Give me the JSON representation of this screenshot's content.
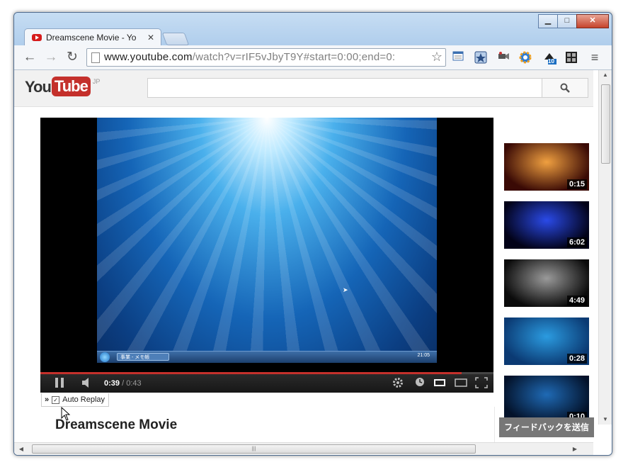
{
  "window": {
    "minimize": "▁",
    "maximize": "□",
    "close": "✕"
  },
  "tab": {
    "title": "Dreamscene Movie - Yo",
    "close": "✕"
  },
  "toolbar": {
    "back": "←",
    "forward": "→",
    "reload": "↻",
    "url_host": "www.youtube.com",
    "url_rest": "/watch?v=rIF5vJbyT9Y#start=0:00;end=0:",
    "star": "☆",
    "menu": "≡"
  },
  "extensions": [
    "ext-1",
    "ext-2",
    "ext-3",
    "ext-4",
    "ext-5",
    "ext-6"
  ],
  "extension_badge": "10",
  "masthead": {
    "logo_you": "You",
    "logo_tube": "Tube",
    "logo_region": "JP",
    "search_placeholder": "",
    "search_icon": "search-icon"
  },
  "player": {
    "desktop_taskbar_app": "事業 - メモ帳",
    "desktop_clock": "21:05",
    "current_time": "0:39",
    "duration": "0:43",
    "time_sep": " / ",
    "progress": 0.93
  },
  "autoreplay": {
    "chevron": "»",
    "checked": "✓",
    "label": "Auto Replay"
  },
  "video": {
    "title": "Dreamscene Movie"
  },
  "related": [
    {
      "duration": "0:15",
      "color_a": "#3a0a05",
      "color_b": "#f0a040"
    },
    {
      "duration": "6:02",
      "color_a": "#020218",
      "color_b": "#2a4ae8"
    },
    {
      "duration": "4:49",
      "color_a": "#0b0b0b",
      "color_b": "#9a9a9a"
    },
    {
      "duration": "0:28",
      "color_a": "#0b3a73",
      "color_b": "#2b9be0"
    },
    {
      "duration": "0:10",
      "color_a": "#03122a",
      "color_b": "#1f6ab5"
    }
  ],
  "feedback": {
    "label": "フィードバックを送信"
  }
}
